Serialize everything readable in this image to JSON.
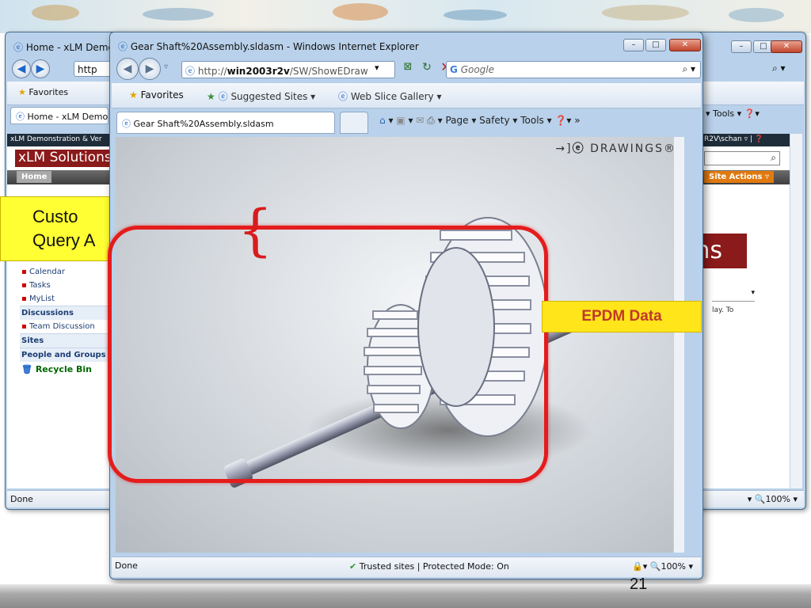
{
  "slide": {
    "page_number": "21"
  },
  "back_window": {
    "title": "Home - xLM Demor",
    "address": "http",
    "tab": "Home - xLM Demo",
    "favorites": "Favorites",
    "site_header": "xLM Demonstration & Ver",
    "site_logo": "xLM Solutions",
    "home_tab": "Home",
    "user_menu": "R2V\\schan",
    "site_actions": "Site Actions",
    "tools_menu": "Tools",
    "big_heading_fragment": "ons",
    "dropdown_label": "",
    "desc_fragment": "lay. To",
    "nav_items": [
      "Calendar",
      "Tasks",
      "MyList"
    ],
    "discussions_header": "Discussions",
    "discussion_items": [
      "Team Discussion"
    ],
    "sites_header": "Sites",
    "people_header": "People and Groups",
    "recycle_bin": "Recycle Bin",
    "status_text": "Done",
    "zoom": "100%",
    "callout_line1": "Custo",
    "callout_line2": "Query A"
  },
  "front_window": {
    "title": "Gear Shaft%20Assembly.sldasm - Windows Internet Explorer",
    "address_prefix": "http://",
    "address_host": "win2003r2v",
    "address_path": "/SW/ShowEDraw",
    "search_engine": "Google",
    "favorites": "Favorites",
    "suggested_sites": "Suggested Sites",
    "web_slice_gallery": "Web Slice Gallery",
    "tab": "Gear Shaft%20Assembly.sldasm",
    "page_menu": "Page",
    "safety_menu": "Safety",
    "tools_menu": "Tools",
    "edrawings_logo": "DRAWINGS",
    "status_text": "Done",
    "security_zone": "Trusted sites | Protected Mode: On",
    "zoom": "100%"
  },
  "annotations": {
    "epdm_label": "EPDM Data"
  },
  "colors": {
    "callout_yellow": "#ffff33",
    "red_box": "#e41c1c",
    "epdm_text": "#c0392b",
    "sharepoint_red": "#8b1a1a"
  }
}
